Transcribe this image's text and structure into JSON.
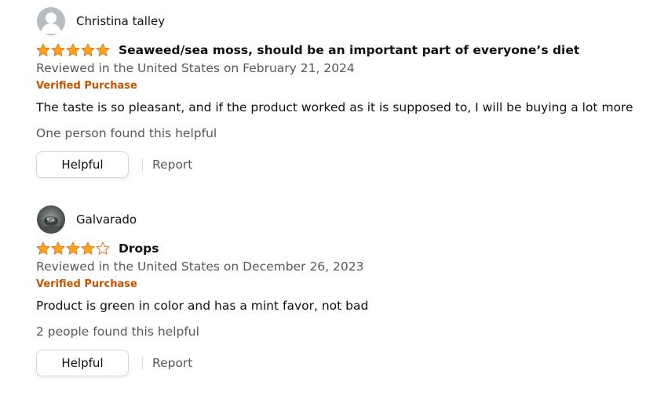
{
  "reviews": [
    {
      "reviewer_name": "Christina talley",
      "avatar": "default-avatar",
      "rating": 5,
      "title": "Seaweed/sea moss, should be an important part of everyone’s diet",
      "date": "Reviewed in the United States on February 21, 2024",
      "verified": "Verified Purchase",
      "body": "The taste is so pleasant, and if the product worked as it is supposed to, I will be buying a lot more",
      "helpful_count": "One person found this helpful",
      "helpful_label": "Helpful",
      "report_label": "Report"
    },
    {
      "reviewer_name": "Galvarado",
      "avatar": "photo-avatar",
      "rating": 4,
      "title": "Drops",
      "date": "Reviewed in the United States on December 26, 2023",
      "verified": "Verified Purchase",
      "body": "Product is green in color and has a mint favor, not bad",
      "helpful_count": "2 people found this helpful",
      "helpful_label": "Helpful",
      "report_label": "Report"
    }
  ],
  "colors": {
    "star_fill": "#ffa41c",
    "star_outline": "#de7921",
    "verified": "#c45500",
    "secondary_text": "#565959"
  }
}
